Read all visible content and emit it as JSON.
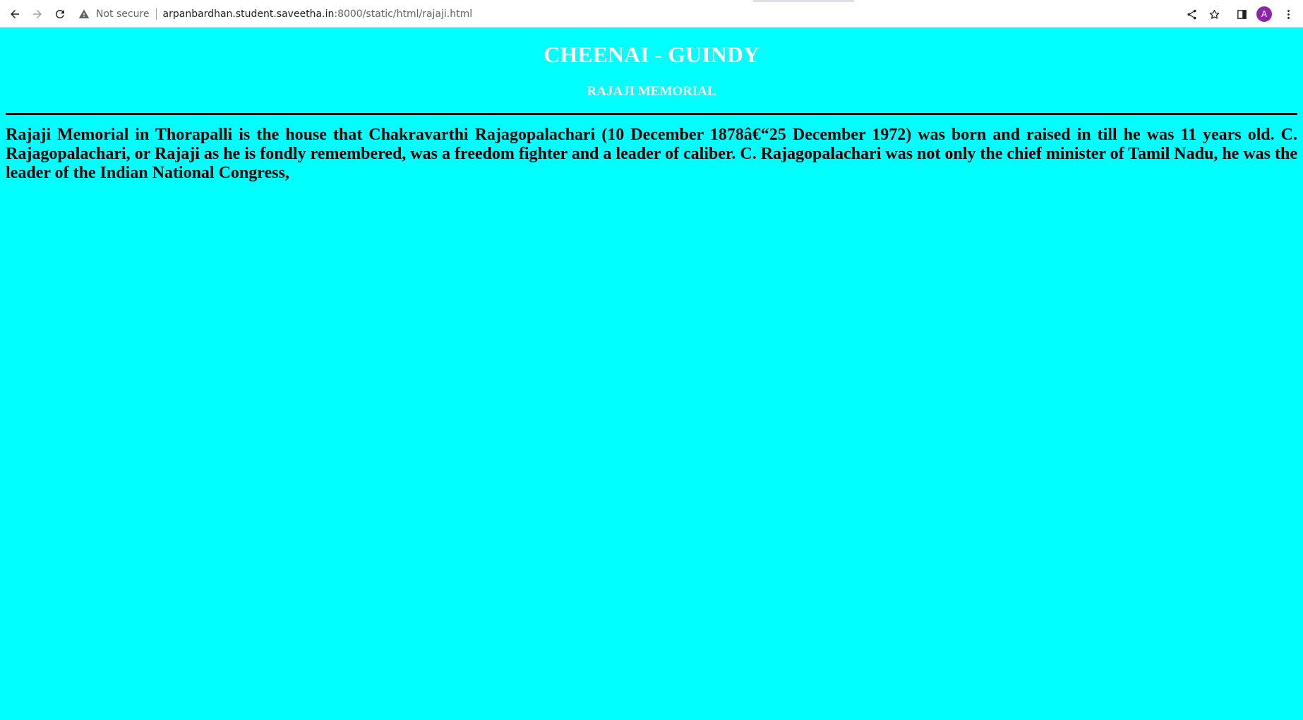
{
  "browser": {
    "security_label": "Not secure",
    "url_host": "arpanbardhan.student.saveetha.in",
    "url_rest": ":8000/static/html/rajaji.html",
    "avatar_letter": "A",
    "icons": [
      "back-icon",
      "forward-icon",
      "reload-icon",
      "warning-icon",
      "share-icon",
      "star-icon",
      "side-panel-icon",
      "avatar",
      "kebab-menu-icon"
    ]
  },
  "page": {
    "title": "CHEENAI - GUINDY",
    "subtitle": "RAJAJI MEMORIAL",
    "paragraph": "Rajaji Memorial in Thorapalli is the house that Chakravarthi Rajagopalachari (10 December 1878â€“25 December 1972) was born and raised in till he was 11 years old. C. Rajagopalachari, or Rajaji as he is fondly remembered, was a freedom fighter and a leader of caliber. C. Rajagopalachari was not only the chief minister of Tamil Nadu, he was the leader of the Indian National Congress,",
    "background_color": "#00ffff",
    "heading_color": "#ffffff",
    "text_color": "#000000"
  }
}
